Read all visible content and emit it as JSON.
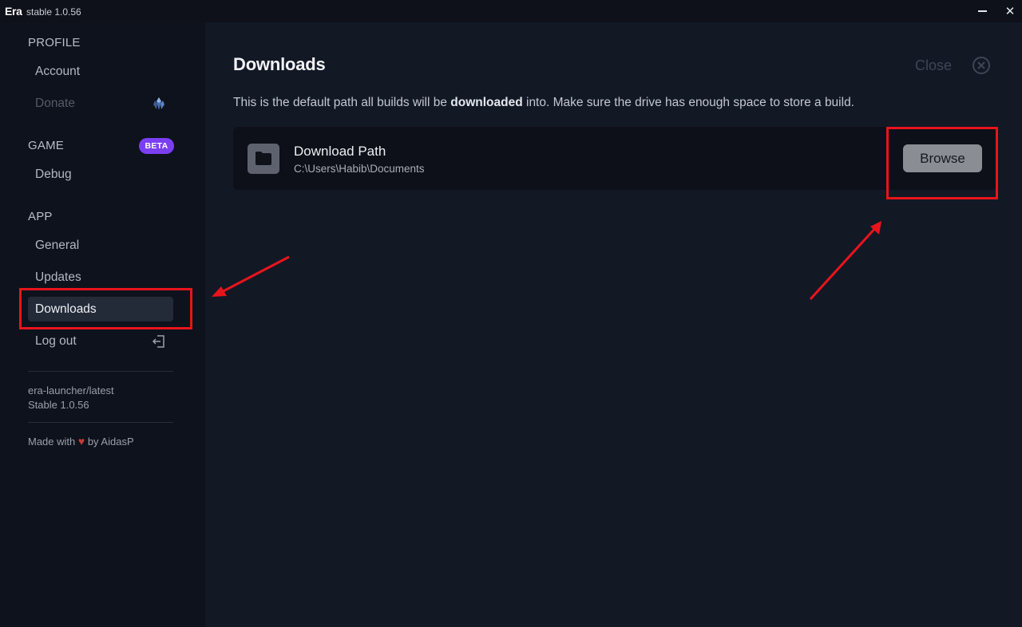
{
  "window": {
    "brand": "Era",
    "version": "stable 1.0.56",
    "minimize_icon": "minimize-icon",
    "close_icon": "close-icon",
    "close_glyph": "✕"
  },
  "sidebar": {
    "sections": [
      {
        "title": "PROFILE",
        "items": [
          {
            "label": "Account"
          },
          {
            "label": "Donate",
            "icon": "crystal-icon",
            "disabled": true
          }
        ]
      },
      {
        "title": "GAME",
        "badge": "BETA",
        "items": [
          {
            "label": "Debug"
          }
        ]
      },
      {
        "title": "APP",
        "items": [
          {
            "label": "General"
          },
          {
            "label": "Updates"
          },
          {
            "label": "Downloads",
            "active": true
          },
          {
            "label": "Log out",
            "icon": "logout-icon"
          }
        ]
      }
    ],
    "build_info": {
      "channel": "era-launcher/latest",
      "version": "Stable 1.0.56"
    },
    "credit": {
      "prefix": "Made with",
      "heart": "♥",
      "suffix": "by AidasP"
    }
  },
  "main": {
    "title": "Downloads",
    "close_label": "Close",
    "description": {
      "before": "This is the default path all builds will be ",
      "bold": "downloaded",
      "after": " into. Make sure the drive has enough space to store a build."
    },
    "download_path": {
      "icon": "folder-icon",
      "title": "Download Path",
      "path": "C:\\Users\\Habib\\Documents",
      "browse_label": "Browse"
    }
  },
  "colors": {
    "background": "#131825",
    "sidebar": "#0e121c",
    "accent_badge": "#7b3ff2",
    "annotation": "#e8141c"
  }
}
